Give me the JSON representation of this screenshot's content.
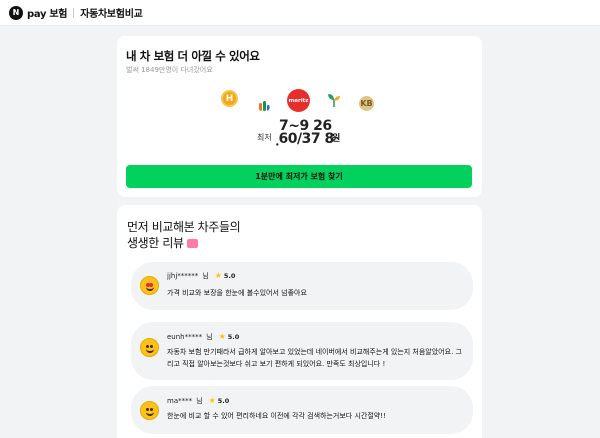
{
  "header": {
    "logo_letter": "N",
    "brand": "pay 보험",
    "service": "자동차보험비교"
  },
  "hero": {
    "title": "내 차 보험 더 아낄 수 있어요",
    "subtitle": "벌써 1849만명이 다녀갔어요",
    "insurers": [
      {
        "icon": "hanwha-logo-icon",
        "label": "H"
      },
      {
        "icon": "db-logo-icon",
        "label": ""
      },
      {
        "icon": "meritz-logo-icon",
        "label": "meritz"
      },
      {
        "icon": "sprout-logo-icon",
        "label": ""
      },
      {
        "icon": "kb-logo-icon",
        "label": "KB"
      }
    ],
    "price_label": "최저",
    "price_line1": "7~9 26",
    "price_line2": "ฺ60/37 8",
    "price_unit": "원",
    "cta_label": "1분만에 최저가 보험 찾기"
  },
  "reviews_section": {
    "title_line1": "먼저 비교해본 차주들의",
    "title_line2": "생생한 리뷰",
    "reviews": [
      {
        "user": "jjhj******",
        "suffix": "님",
        "score": "5.0",
        "text": "가격 비교와 보장을 한눈에 볼수있어서 넘좋아요",
        "emoji": "heart-eyes-emoji-icon"
      },
      {
        "user": "eunh*****",
        "suffix": "님",
        "score": "5.0",
        "text": "자동차 보험 만기때라서 급하게 알아보고 있었는데 네이버에서 비교해주는게 있는지 처음알았어요. 그리고 직접 알아보는것보다 쉬고 보기 편하게 되있어요. 만족도 최상입니다 !",
        "emoji": "grin-emoji-icon"
      },
      {
        "user": "ma****",
        "suffix": "님",
        "score": "5.0",
        "text": "한눈에 비교 할 수 있어 편리하네요 이전에 각각 검색하는거보다 시간절약!!",
        "emoji": "smile-emoji-icon"
      }
    ]
  },
  "colors": {
    "accent_green": "#03d15d",
    "meritz_red": "#e62f2b",
    "hanwha_orange": "#f1a90f",
    "star": "#ffc400"
  }
}
